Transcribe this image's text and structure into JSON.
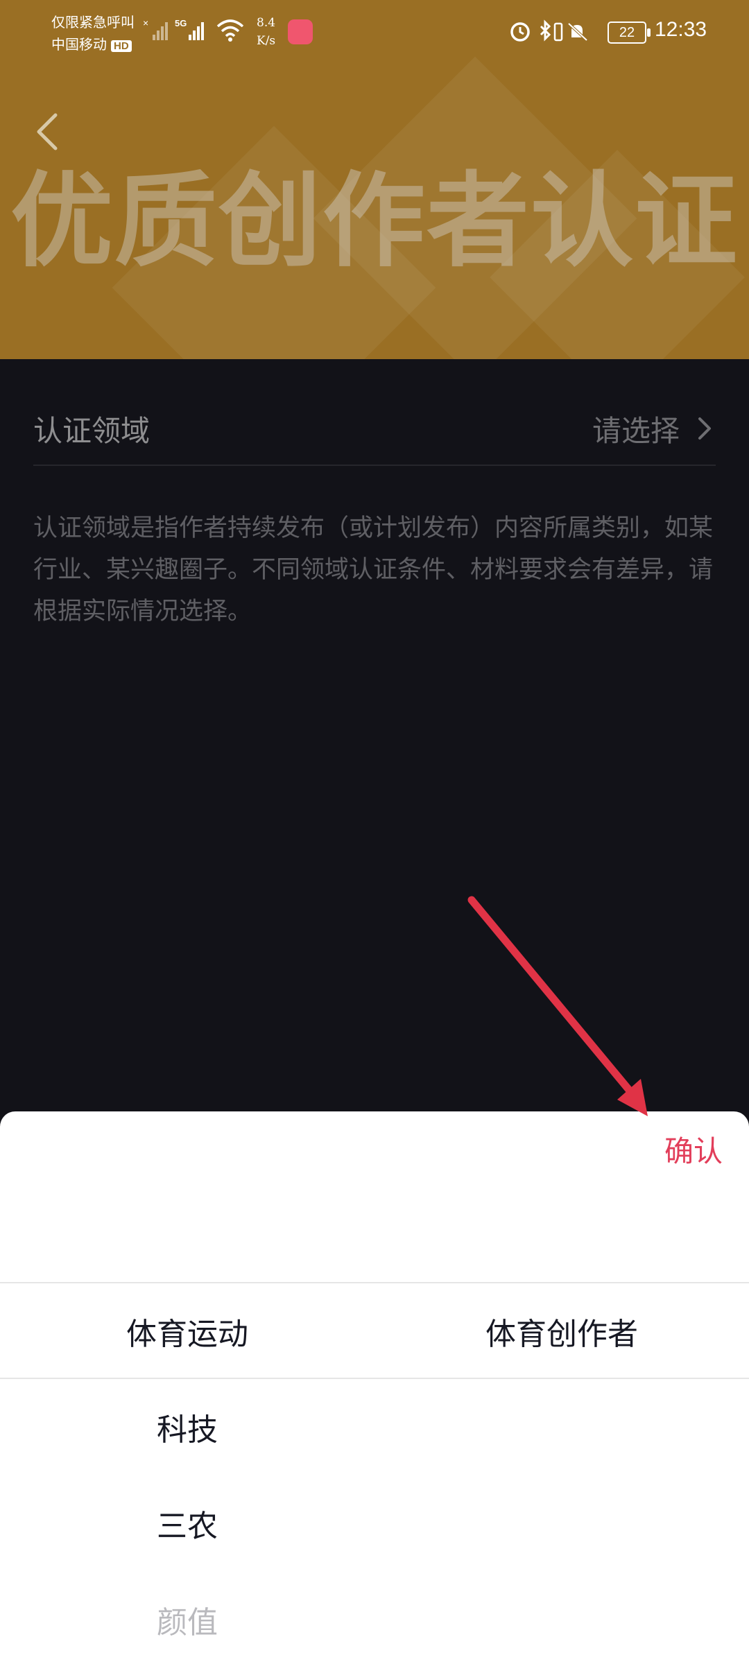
{
  "status_bar": {
    "line1": "仅限紧急呼叫",
    "line2": "中国移动",
    "hd": "HD",
    "network": "5G",
    "speed_value": "8.4",
    "speed_unit": "K/s",
    "battery": "22",
    "time": "12:33",
    "icons": [
      "alarm-icon",
      "bluetooth-icon",
      "vibrate-icon",
      "mute-icon"
    ]
  },
  "header": {
    "title": "优质创作者认证",
    "back_icon": "chevron-left-icon"
  },
  "field": {
    "label": "认证领域",
    "value": "请选择",
    "icon": "chevron-right-icon"
  },
  "description": "认证领域是指作者持续发布（或计划发布）内容所属类别，如某行业、某兴趣圈子。不同领域认证条件、材料要求会有差异，请根据实际情况选择。",
  "sheet": {
    "confirm": "确认",
    "left_column": {
      "selected": "体育运动",
      "options": [
        "科技",
        "三农",
        "颜值"
      ]
    },
    "right_column": {
      "selected": "体育创作者"
    }
  },
  "colors": {
    "header_bg": "#9a6f24",
    "page_bg": "#121218",
    "accent": "#e23e5a",
    "annotation_arrow": "#e03346"
  }
}
